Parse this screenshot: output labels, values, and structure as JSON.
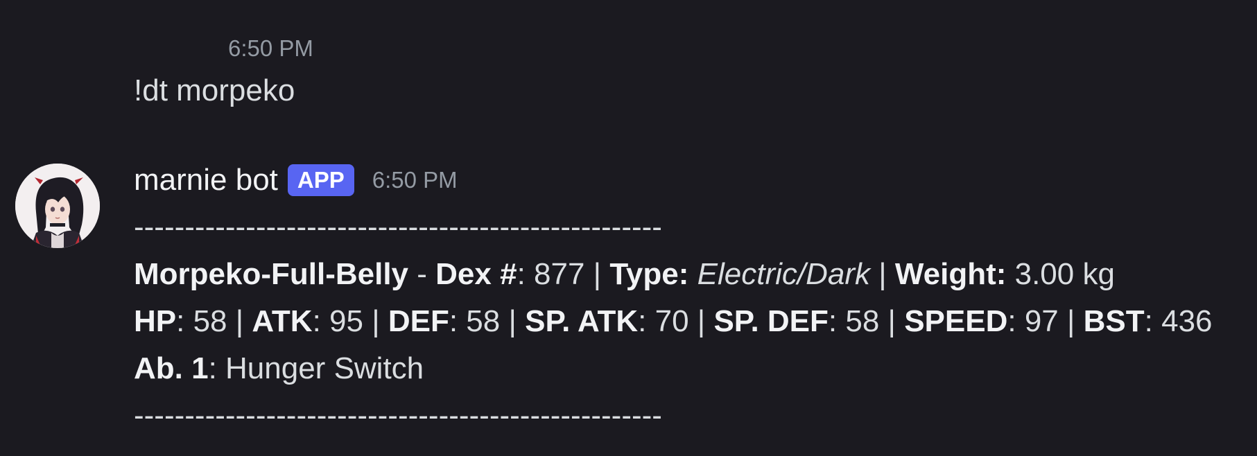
{
  "previous_message": {
    "timestamp": "6:50 PM",
    "text": "!dt morpeko"
  },
  "message": {
    "username": "marnie bot",
    "badge": "APP",
    "timestamp": "6:50 PM",
    "divider_top": "----------------------------------------------------",
    "line1": {
      "name": "Morpeko-Full-Belly",
      "dash": " - ",
      "dex_label": "Dex #",
      "dex_value": ": 877 ",
      "pipe1": "| ",
      "type_label": "Type:",
      "type_value": " Electric/Dark ",
      "pipe2": "| ",
      "weight_label": "Weight:",
      "weight_value": " 3.00 kg"
    },
    "line2": {
      "hp_label": "HP",
      "hp_value": ": 58 | ",
      "atk_label": "ATK",
      "atk_value": ": 95 | ",
      "def_label": "DEF",
      "def_value": ": 58 | ",
      "spatk_label": "SP. ATK",
      "spatk_value": ": 70 | ",
      "spdef_label": "SP. DEF",
      "spdef_value": ": 58 | ",
      "speed_label": "SPEED",
      "speed_value": ": 97 | ",
      "bst_label": "BST",
      "bst_value": ": 436"
    },
    "line3": {
      "ability_label": "Ab. 1",
      "ability_value": ": Hunger Switch"
    },
    "divider_bottom": "----------------------------------------------------"
  },
  "colors": {
    "background": "#1b1a20",
    "badge": "#5865f2",
    "timestamp": "#949ba4",
    "text": "#dbdee1"
  },
  "icons": {
    "avatar": "avatar-image"
  }
}
